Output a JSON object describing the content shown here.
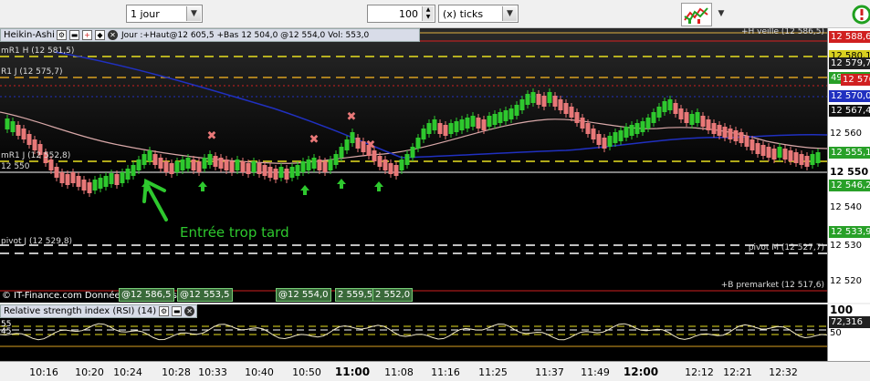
{
  "toolbar": {
    "period_value": "1 jour",
    "tick_count": "100",
    "tick_unit": "(x) ticks"
  },
  "chart": {
    "title": "Heikin-Ashi",
    "header_info": "Jour :+Haut@12 605,5 +Bas 12 504,0 @12 554,0 Vol: 553,0",
    "level_labels": {
      "mR1_H": "mR1 H (12 581,5)",
      "R1_J": "R1 J (12 575,7)",
      "mR1_J": "mR1 J (12 552,8)",
      "v12550": "12 550",
      "pivot_J": "pivot J (12 529,8)",
      "H_veille": "+H veille (12 586,5)",
      "pivot_M": "pivot M (12 527,7)",
      "B_premarket": "+B premarket (12 517,6)"
    },
    "annotation": "Entrée trop tard",
    "watermark": "© IT-Finance.com Données indicatives",
    "tags": [
      "@12 586,5",
      "@12 553,5",
      "@12 554,0",
      "2 559,5",
      "2 552,0"
    ],
    "yaxis": {
      "ticks": [
        "12 560",
        "12 550",
        "12 540",
        "12 530",
        "12 520"
      ],
      "tags": [
        {
          "text": "12 588,6",
          "color": "#d02020",
          "fg": "#fff"
        },
        {
          "text": "12 580,1",
          "color": "#d8d020",
          "fg": "#000"
        },
        {
          "text": "12 579,7",
          "color": "#202020",
          "fg": "#fff"
        },
        {
          "text": "491",
          "color": "#28a028",
          "fg": "#fff"
        },
        {
          "text": "12 576,3",
          "color": "#d02020",
          "fg": "#fff"
        },
        {
          "text": "12 570,0",
          "color": "#2030c0",
          "fg": "#fff"
        },
        {
          "text": "12 567,4",
          "color": "#101010",
          "fg": "#fff"
        },
        {
          "text": "12 555,1",
          "color": "#28a028",
          "fg": "#fff"
        },
        {
          "text": "12 546,2",
          "color": "#28a028",
          "fg": "#fff"
        },
        {
          "text": "12 533,9",
          "color": "#28a028",
          "fg": "#fff"
        }
      ]
    }
  },
  "rsi": {
    "title": "Relative strength index (RSI) (14)",
    "left_ticks": [
      "55",
      "45"
    ],
    "axis_top": "100",
    "current": "72,316",
    "mid": "50"
  },
  "xaxis": {
    "ticks": [
      "10:16",
      "10:20",
      "10:24",
      "10:28",
      "10:33",
      "10:40",
      "10:50",
      "11:00",
      "11:08",
      "11:16",
      "11:25",
      "11:37",
      "11:49",
      "12:00",
      "12:12",
      "12:21",
      "12:32"
    ]
  },
  "colors": {
    "bull": "#2ec82e",
    "bear": "#e87878",
    "ma_fast": "#d8a8a8",
    "ma_slow": "#2030c0"
  }
}
